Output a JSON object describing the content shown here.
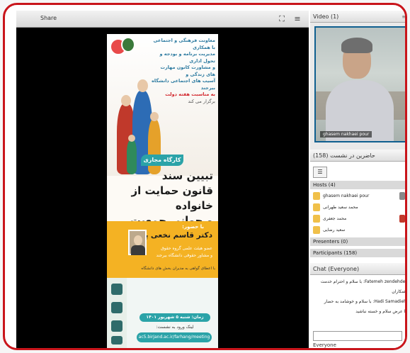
{
  "share": {
    "title": "Share",
    "controls": {
      "full": "⛶",
      "menu": "≡"
    }
  },
  "poster": {
    "intro_lines": [
      "معاونت فرهنگی و اجتماعی با همکاری",
      "مدیریت برنامه و بودجه و تحول اداری",
      "و مشاورت کانون مهارت های زندگی و",
      "آسیب های اجتماعی دانشگاه بیرجند"
    ],
    "occasion": "به مناسبت هفته دولت",
    "held": "برگزار می کند",
    "workshop": "کارگاه مجازی",
    "title_lines": [
      "تبیین سند",
      "قانون حمایت از خانواده",
      "و جوانی جمعیت"
    ],
    "by": "با حضور:",
    "speaker": "دکتر قاسم نخعی پور",
    "speaker_info": [
      "عضو هیئت علمی گروه حقوق",
      "و مشاور حقوقی دانشگاه بیرجند"
    ],
    "note": "با اعطای گواهی به مدیران بخش های دانشگاه",
    "date": "زمان: شنبه ۵ شهریور ۱۴۰۱ ساعت ۱۲",
    "link_label": "لینک ورود به نشست:",
    "url": "ac5.birjand.ac.ir/farhang/meeting"
  },
  "video": {
    "title": "Video (1)",
    "name_tag": "ghasem nakhaei pour"
  },
  "attendees": {
    "title": "حاضرین در نشست (158)",
    "hosts": "Hosts (4)",
    "host_list": [
      "ghasem nakhaei pour",
      "محمد سعید طهرانی",
      "محمد جعفری",
      "سعید رضایی"
    ],
    "presenters": "Presenters (0)",
    "participants": "Participants (158)"
  },
  "chat": {
    "title": "Chat (Everyone)",
    "messages": [
      "Fatemeh zendehdel: با سلام و احترام خدمت همکاران",
      "Hadi Samadieh: با سلام و خوشامد به حضار",
      "با عرض سلام و خسته نباشید"
    ],
    "footer": "Everyone"
  }
}
